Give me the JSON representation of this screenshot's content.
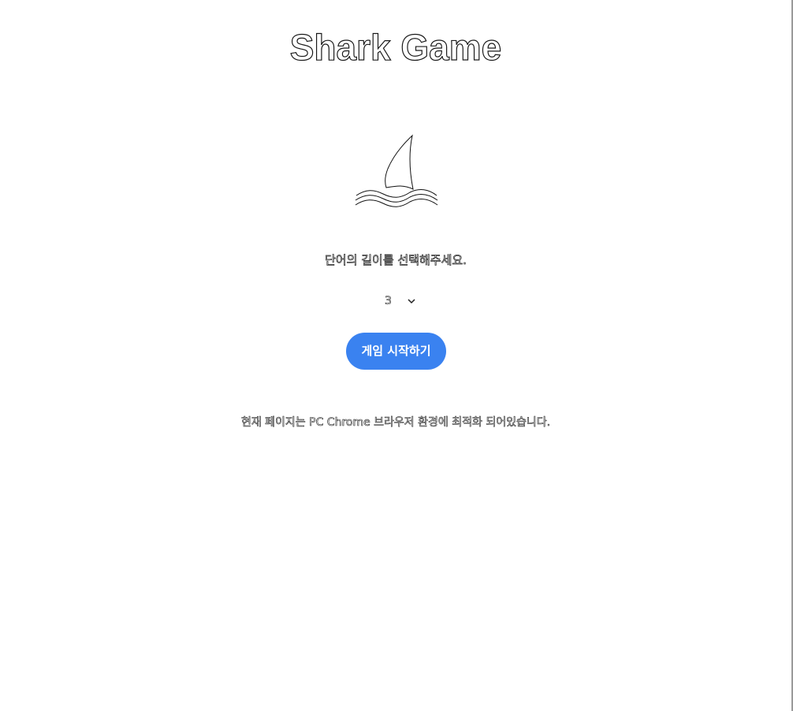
{
  "header": {
    "title": "Shark Game"
  },
  "logo": {
    "icon": "shark-fin-icon"
  },
  "word_length": {
    "prompt": "단어의 길이를 선택해주세요.",
    "selected": "3"
  },
  "actions": {
    "start_label": "게임 시작하기"
  },
  "footer": {
    "notice": "현재 페이지는 PC Chrome 브라우저 환경에 최적화 되어있습니다."
  },
  "colors": {
    "accent": "#3a82f0"
  }
}
